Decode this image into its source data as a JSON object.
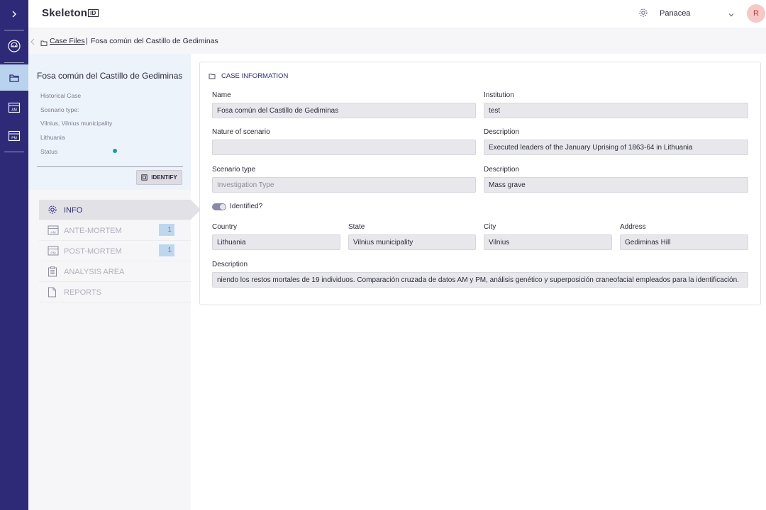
{
  "app": {
    "logo_text": "Skeleton",
    "logo_suffix": "ID",
    "org_name": "Panacea",
    "user_initial": "R"
  },
  "breadcrumb": {
    "link": "Case Files",
    "separator": "|",
    "current": "Fosa común del Castillo de Gediminas"
  },
  "case": {
    "title": "Fosa común del Castillo de Gediminas",
    "type": "Historical Case",
    "scenario_type": "Scenario type:",
    "location": "Vilnius, Vilnius municipality",
    "country": "Lithuania",
    "status_label": "Status",
    "status_color": "#1aa192",
    "identify_label": "IDENTIFY"
  },
  "nav": [
    {
      "label": "INFO",
      "icon": "gear-icon",
      "active": true
    },
    {
      "label": "ANTE-MORTEM",
      "icon": "am-icon",
      "count": "1"
    },
    {
      "label": "POST-MORTEM",
      "icon": "pm-icon",
      "count": "1"
    },
    {
      "label": "ANALYSIS AREA",
      "icon": "clipboard-icon"
    },
    {
      "label": "REPORTS",
      "icon": "document-icon"
    }
  ],
  "case_info": {
    "section_title": "CASE INFORMATION",
    "name_label": "Name",
    "name_value": "Fosa común del Castillo de Gediminas",
    "institution_label": "Institution",
    "institution_value": "test",
    "nature_label": "Nature of scenario",
    "nature_value": "",
    "description1_label": "Description",
    "description1_value": "Executed leaders of the January Uprising of 1863-64 in Lithuania",
    "scenario_type_label": "Scenario type",
    "scenario_type_placeholder": "Investigation Type",
    "description2_label": "Description",
    "description2_value": "Mass grave",
    "identified_label": "Identified?",
    "identified_on": true,
    "country_label": "Country",
    "country_value": "Lithuania",
    "state_label": "State",
    "state_value": "Vilnius municipality",
    "city_label": "City",
    "city_value": "Vilnius",
    "address_label": "Address",
    "address_value": "Gediminas Hill",
    "description3_label": "Description",
    "description3_value": "niendo los restos mortales de 19 individuos. Comparación cruzada de datos AM y PM, análisis genético y superposición craneofacial empleados para la identificación."
  }
}
